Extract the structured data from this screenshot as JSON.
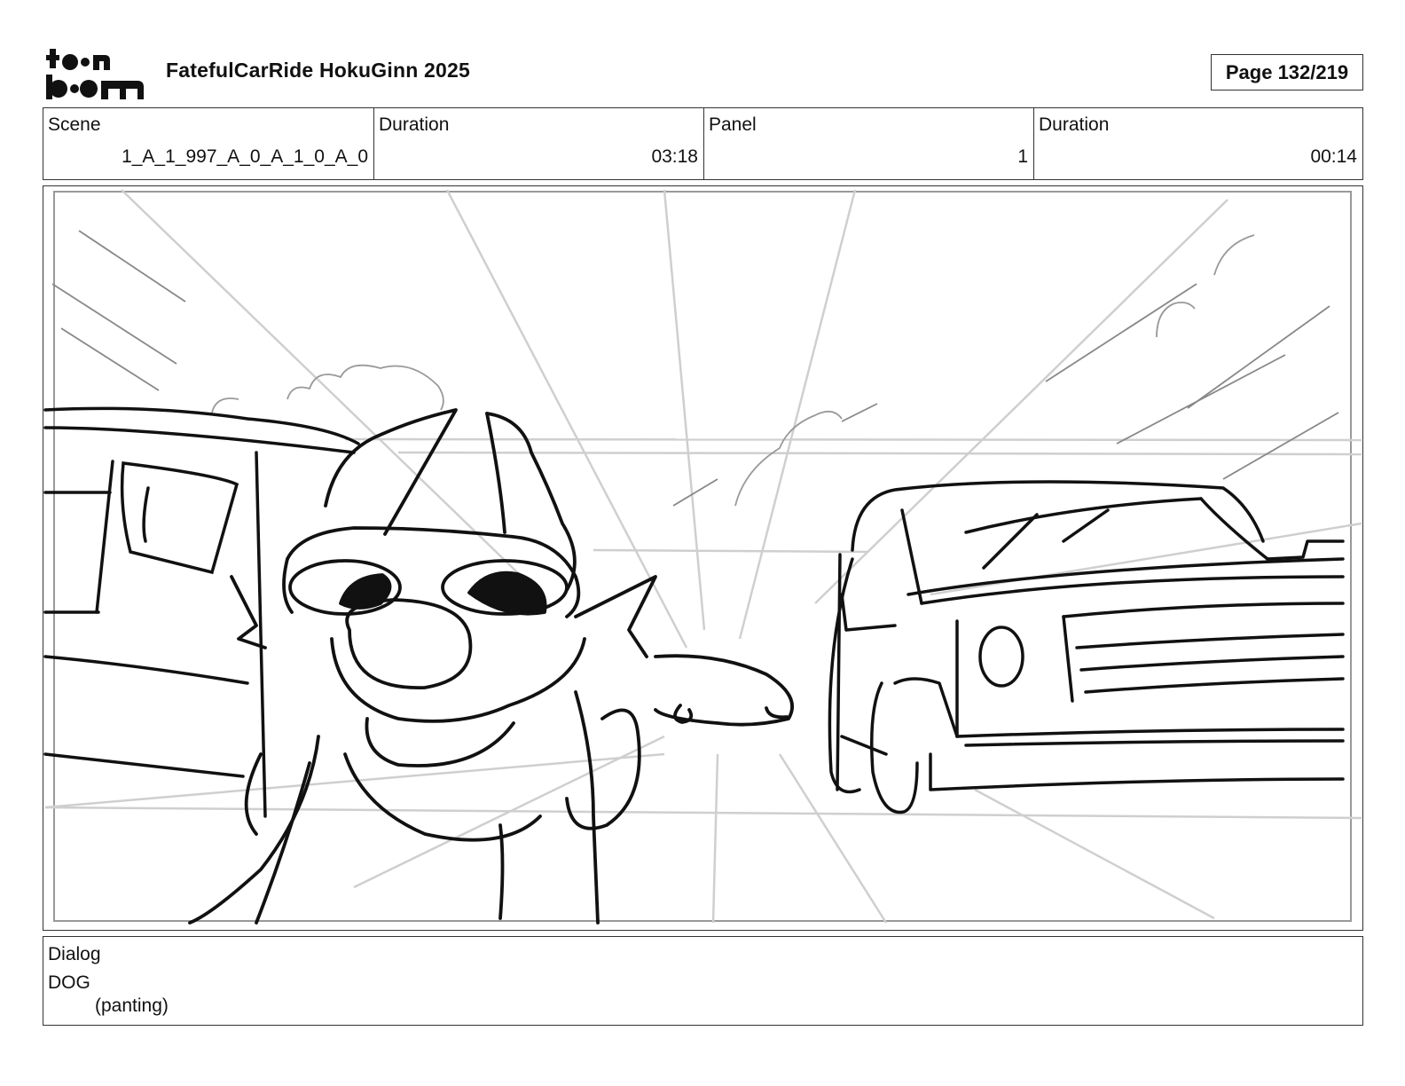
{
  "logo": {
    "line1": "toon",
    "line2": "boom"
  },
  "header": {
    "title": "FatefulCarRide HokuGinn 2025",
    "page": "Page 132/219"
  },
  "info": {
    "scene_label": "Scene",
    "scene_value": "1_A_1_997_A_0_A_1_0_A_0",
    "duration_label": "Duration",
    "duration_value": "03:18",
    "panel_label": "Panel",
    "panel_value": "1",
    "panel_duration_label": "Duration",
    "panel_duration_value": "00:14"
  },
  "panel": {
    "content": "rough pencil storyboard sketch: dog with head out of a car window, tongue flapping in the wind, oncoming car on the right"
  },
  "dialog": {
    "label": "Dialog",
    "character": "DOG",
    "parenthetical": "(panting)"
  }
}
